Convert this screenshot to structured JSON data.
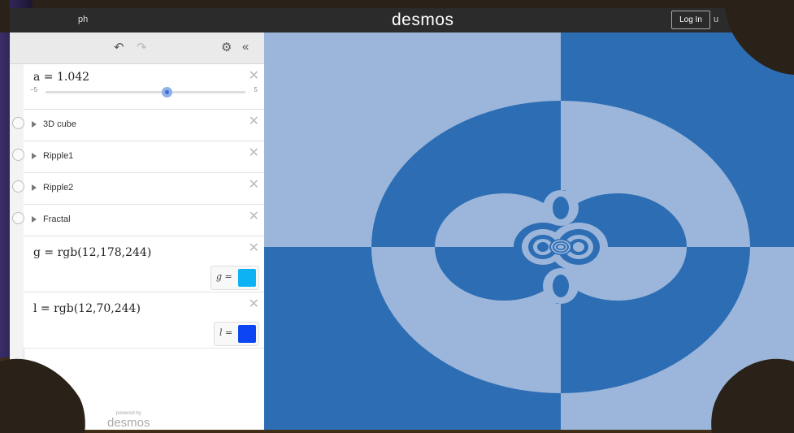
{
  "topbar": {
    "crumb": "ph",
    "logo": "desmos",
    "login_label": "Log In",
    "more": "u"
  },
  "toolbar": {
    "undo_icon": "undo-icon",
    "redo_icon": "redo-icon",
    "settings_icon": "gear-icon",
    "collapse_icon": "double-chevron-left-icon"
  },
  "expressions": [
    {
      "type": "slider",
      "latex": "a = 1.042",
      "min": "−5",
      "max": "5",
      "value_fraction": 0.604
    },
    {
      "type": "folder",
      "label": "3D cube"
    },
    {
      "type": "folder",
      "label": "Ripple1"
    },
    {
      "type": "folder",
      "label": "Ripple2"
    },
    {
      "type": "folder",
      "label": "Fractal"
    },
    {
      "type": "color",
      "latex": "g = rgb(12,178,244)",
      "swatch_label": "g  =",
      "color": "#0cb2f4"
    },
    {
      "type": "color",
      "latex": "l = rgb(12,70,244)",
      "swatch_label": "l  =",
      "color": "#0c46f4"
    }
  ],
  "powered": {
    "small": "powered by",
    "big": "desmos"
  },
  "graph": {
    "light": "#9bb6da",
    "dark": "#2d6db4"
  }
}
